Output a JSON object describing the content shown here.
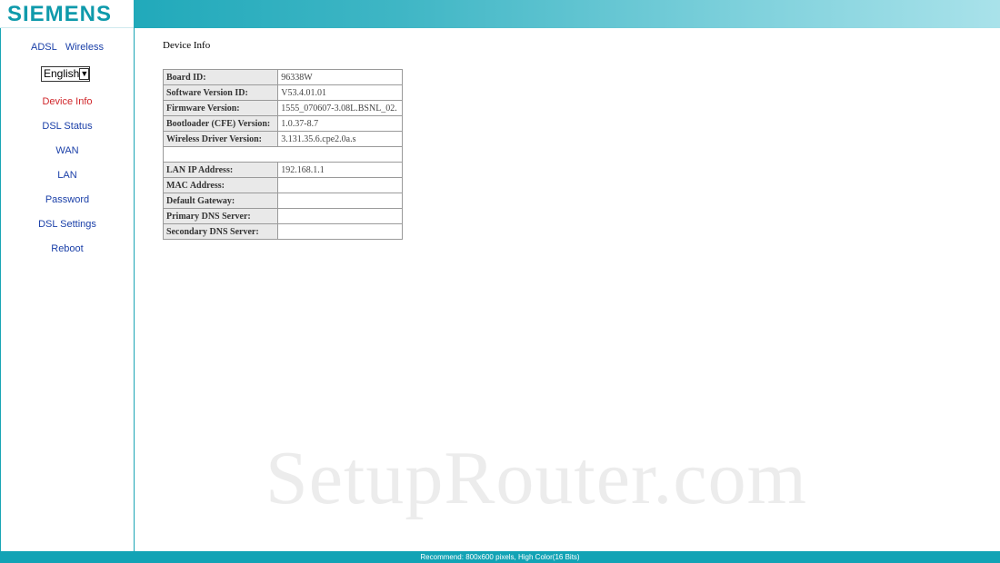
{
  "header": {
    "logo_text": "SIEMENS"
  },
  "sidebar": {
    "top_links": [
      "ADSL",
      "Wireless"
    ],
    "language": {
      "selected": "English"
    },
    "menu": [
      {
        "label": "Device Info",
        "active": true
      },
      {
        "label": "DSL Status"
      },
      {
        "label": "WAN"
      },
      {
        "label": "LAN"
      },
      {
        "label": "Password"
      },
      {
        "label": "DSL Settings"
      },
      {
        "label": "Reboot"
      }
    ]
  },
  "main": {
    "title": "Device Info",
    "rows": [
      {
        "label": "Board ID:",
        "value": "96338W"
      },
      {
        "label": "Software Version ID:",
        "value": "V53.4.01.01"
      },
      {
        "label": "Firmware Version:",
        "value": "1555_070607-3.08L.BSNL_02."
      },
      {
        "label": "Bootloader (CFE) Version:",
        "value": "1.0.37-8.7"
      },
      {
        "label": "Wireless Driver Version:",
        "value": "3.131.35.6.cpe2.0a.s"
      },
      {
        "label": "",
        "value": ""
      },
      {
        "label": "LAN IP Address:",
        "value": "192.168.1.1"
      },
      {
        "label": "MAC Address:",
        "value": ""
      },
      {
        "label": "Default Gateway:",
        "value": ""
      },
      {
        "label": "Primary DNS Server:",
        "value": ""
      },
      {
        "label": "Secondary DNS Server:",
        "value": ""
      }
    ]
  },
  "watermark": "SetupRouter.com",
  "footer": {
    "text": "Recommend: 800x600 pixels, High Color(16 Bits)"
  },
  "colors": {
    "accent": "#12a3b5",
    "link": "#1a3fa8",
    "active_link": "#d0262a"
  }
}
